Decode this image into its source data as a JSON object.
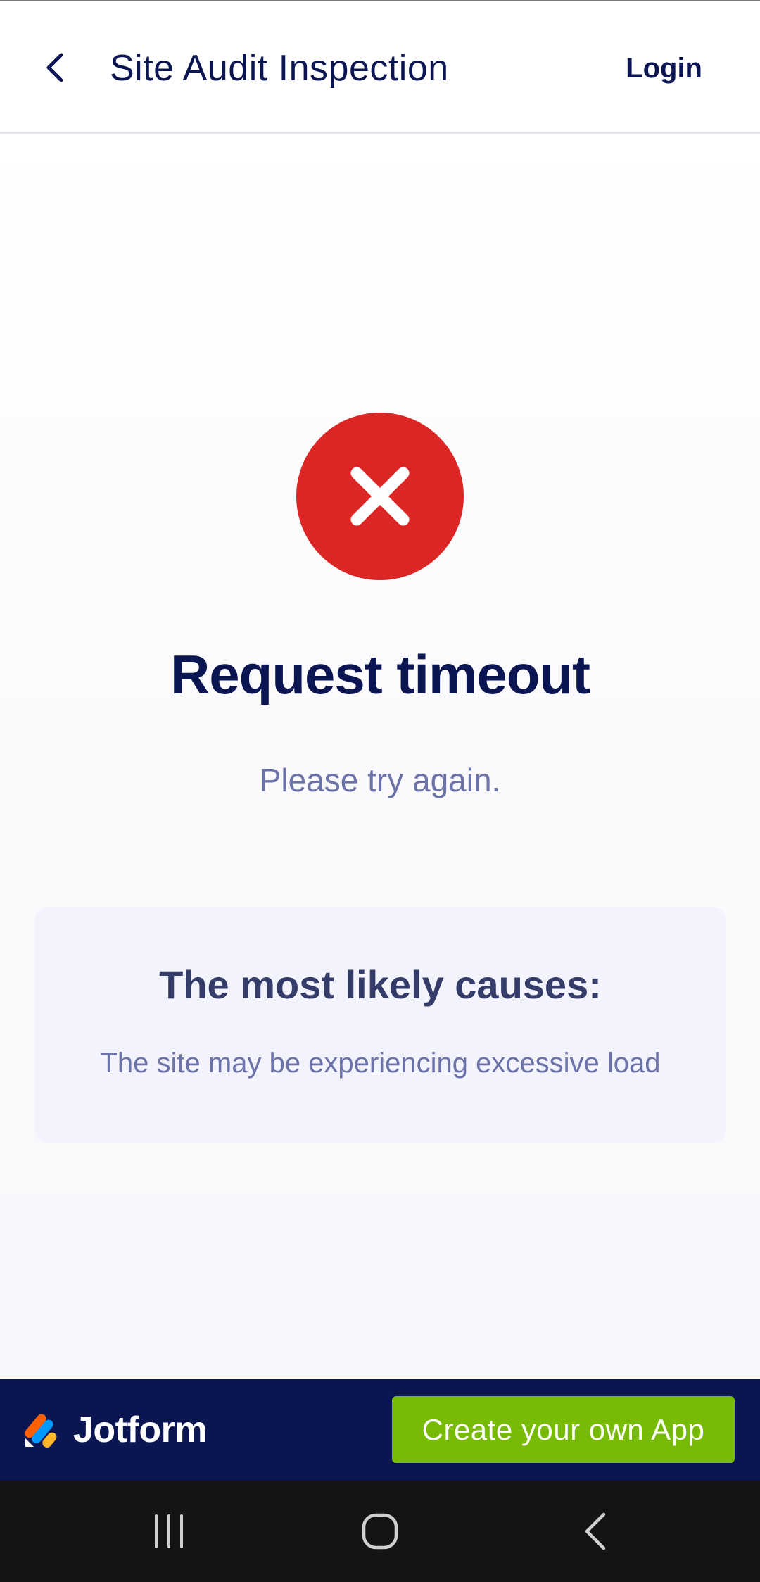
{
  "header": {
    "title": "Site Audit Inspection",
    "login_label": "Login",
    "back_icon": "chevron-left-icon"
  },
  "error": {
    "icon": "x-circle-icon",
    "icon_color": "#dc2626",
    "title": "Request timeout",
    "subtitle": "Please try again."
  },
  "causes": {
    "title": "The most likely causes:",
    "items": [
      "The site may be experiencing excessive load"
    ]
  },
  "footer": {
    "brand_name": "Jotform",
    "cta_label": "Create your own App",
    "cta_color": "#78bb07",
    "background": "#0a1551"
  },
  "system_nav": {
    "buttons": [
      "recent-apps-icon",
      "home-icon",
      "back-icon"
    ]
  }
}
